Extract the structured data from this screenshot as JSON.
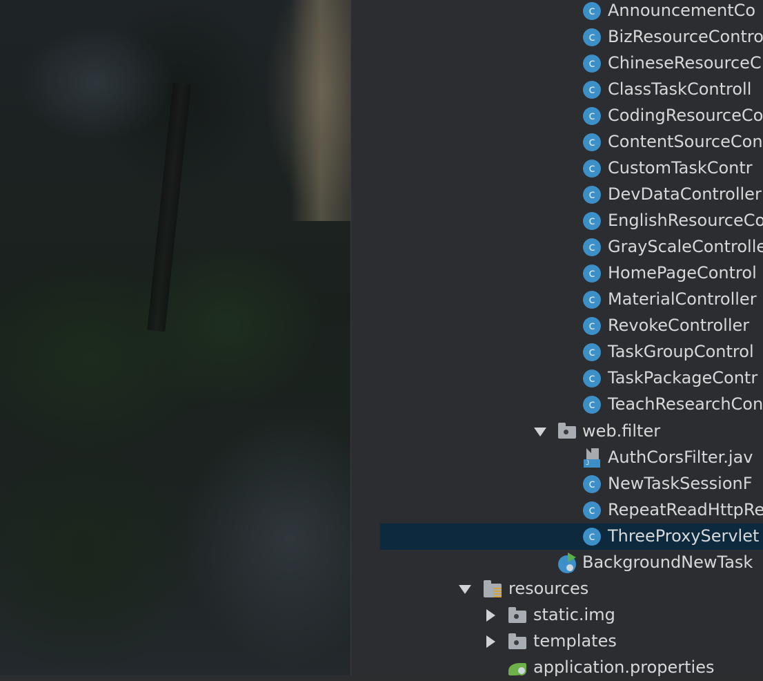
{
  "project_tree": {
    "controller_files": [
      {
        "label": "AnnouncementCo",
        "icon": "class-icon"
      },
      {
        "label": "BizResourceContro",
        "icon": "class-icon"
      },
      {
        "label": "ChineseResourceC",
        "icon": "class-icon"
      },
      {
        "label": "ClassTaskControll",
        "icon": "class-icon"
      },
      {
        "label": "CodingResourceCo",
        "icon": "class-icon"
      },
      {
        "label": "ContentSourceCon",
        "icon": "class-icon"
      },
      {
        "label": "CustomTaskContr",
        "icon": "class-icon"
      },
      {
        "label": "DevDataController",
        "icon": "class-icon"
      },
      {
        "label": "EnglishResourceCo",
        "icon": "class-icon"
      },
      {
        "label": "GrayScaleControlle",
        "icon": "class-icon"
      },
      {
        "label": "HomePageControl",
        "icon": "class-icon"
      },
      {
        "label": "MaterialController",
        "icon": "class-icon"
      },
      {
        "label": "RevokeController",
        "icon": "class-icon"
      },
      {
        "label": "TaskGroupControl",
        "icon": "class-icon"
      },
      {
        "label": "TaskPackageContr",
        "icon": "class-icon"
      },
      {
        "label": "TeachResearchCon",
        "icon": "class-icon"
      }
    ],
    "web_filter": {
      "label": "web.filter",
      "expanded": true,
      "children": [
        {
          "label": "AuthCorsFilter.jav",
          "icon": "java-file-icon",
          "badge": "J"
        },
        {
          "label": "NewTaskSessionF",
          "icon": "class-icon"
        },
        {
          "label": "RepeatReadHttpRe",
          "icon": "class-icon"
        },
        {
          "label": "ThreeProxyServlet",
          "icon": "class-icon",
          "selected": true
        }
      ]
    },
    "app_class": {
      "label": "BackgroundNewTask",
      "icon": "spring-boot-app-icon"
    },
    "resources": {
      "label": "resources",
      "expanded": true,
      "children": [
        {
          "label": "static.img",
          "icon": "folder-icon",
          "expanded": false
        },
        {
          "label": "templates",
          "icon": "folder-icon",
          "expanded": false
        },
        {
          "label": "application.properties",
          "icon": "spring-properties-icon"
        }
      ]
    },
    "class_glyph": "c",
    "colors": {
      "panel_bg": "#2b2d30",
      "selection": "#0d293e",
      "class_icon": "#3d8fc7",
      "text": "#d6d8da"
    }
  }
}
